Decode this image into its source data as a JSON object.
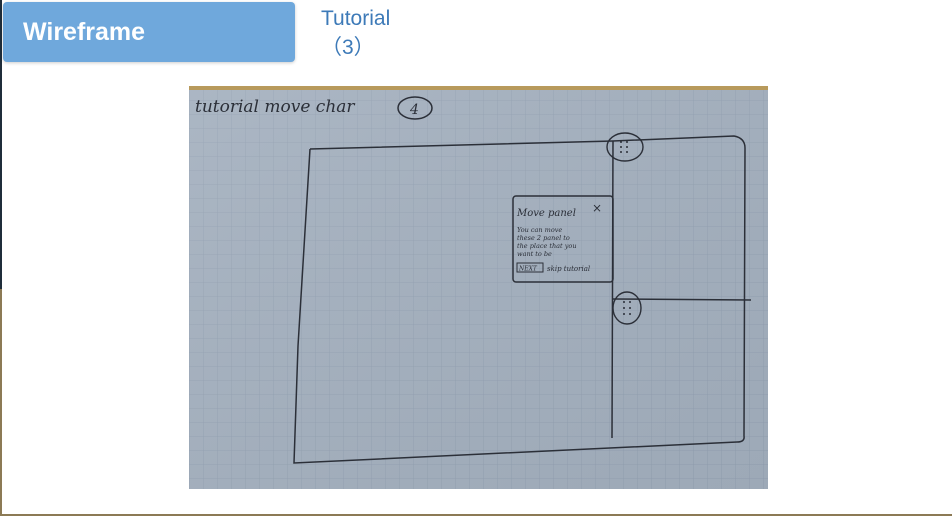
{
  "tabs": [
    {
      "label": "Wireframe",
      "active": true
    },
    {
      "label": "Tutorial（3）",
      "active": false
    }
  ],
  "colors": {
    "active_tab_bg": "#6fa8dc",
    "inactive_tab_text": "#3d7ab8",
    "paper": "#a7b3c1"
  },
  "sketch": {
    "heading": "tutorial  move  char",
    "step_number": "4",
    "panel": {
      "title": "Move panel",
      "close_glyph": "×",
      "body_lines": [
        "You can move",
        "these 2 panel to",
        "the place that you",
        "want to be"
      ],
      "next_label": "NEXT",
      "skip_label": "skip tutorial"
    }
  }
}
